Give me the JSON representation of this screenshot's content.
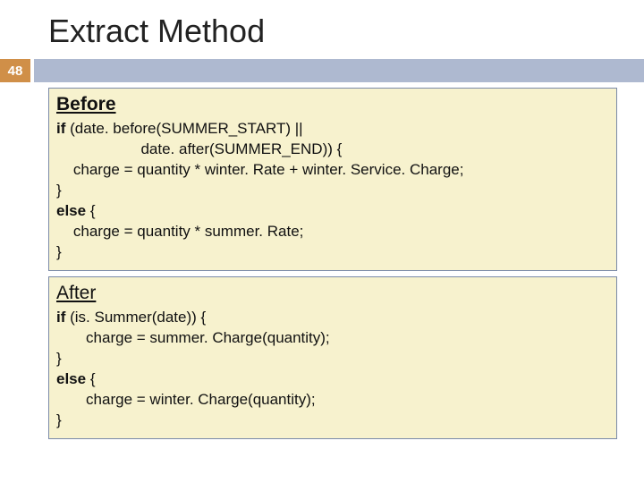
{
  "title": "Extract Method",
  "page_number": "48",
  "before": {
    "heading": "Before",
    "lines": [
      {
        "bold": "if ",
        "rest": "(date. before(SUMMER_START) ||"
      },
      {
        "rest": "                    date. after(SUMMER_END)) {"
      },
      {
        "rest": "    charge = quantity * winter. Rate + winter. Service. Charge;"
      },
      {
        "rest": "}"
      },
      {
        "bold": "else ",
        "rest": "{"
      },
      {
        "rest": "    charge = quantity * summer. Rate;"
      },
      {
        "rest": "}"
      }
    ]
  },
  "after": {
    "heading": "After",
    "lines": [
      {
        "bold": "if ",
        "rest": "(is. Summer(date)) {"
      },
      {
        "rest": "       charge = summer. Charge(quantity);"
      },
      {
        "rest": "}"
      },
      {
        "bold": "else ",
        "rest": "{"
      },
      {
        "rest": "       charge = winter. Charge(quantity);"
      },
      {
        "rest": "}"
      }
    ]
  }
}
